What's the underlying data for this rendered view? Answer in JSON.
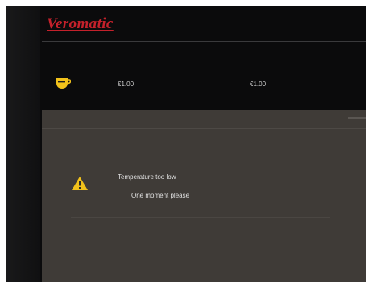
{
  "header": {
    "brand": "Veromatic"
  },
  "product_row": {
    "icon": "cup-icon",
    "prices": [
      "€1.00",
      "€1.00"
    ]
  },
  "message": {
    "icon": "warning-icon",
    "title": "Temperature too low",
    "subtitle": "One moment please"
  },
  "colors": {
    "brand": "#c4212b",
    "accent": "#f2c21b",
    "panel": "#3f3b37",
    "background": "#0b0b0c"
  }
}
